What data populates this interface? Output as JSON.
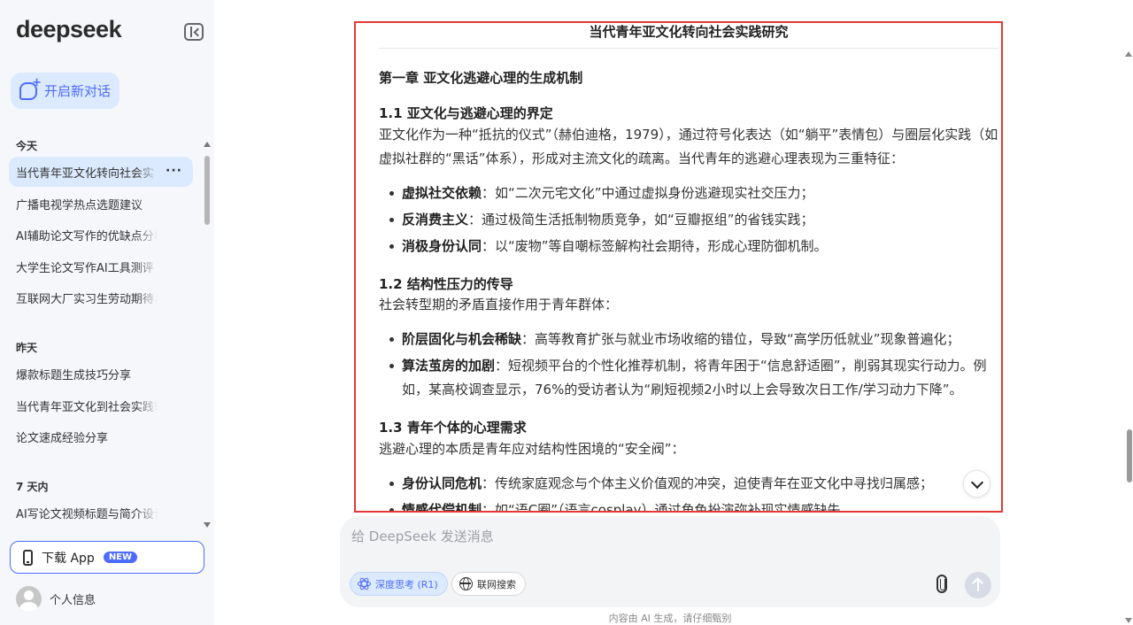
{
  "sidebar": {
    "logo": "deepseek",
    "new_chat_label": "开启新对话",
    "sections": [
      {
        "label": "今天",
        "items": [
          "当代青年亚文化转向社会实",
          "广播电视学热点选题建议",
          "AI辅助论文写作的优缺点分析",
          "大学生论文写作AI工具测评",
          "互联网大厂实习生劳动期待与剧本"
        ]
      },
      {
        "label": "昨天",
        "items": [
          "爆款标题生成技巧分享",
          "当代青年亚文化到社会实践转化研究",
          "论文速成经验分享"
        ]
      },
      {
        "label": "7 天内",
        "items": [
          "AI写论文视频标题与简介设计"
        ]
      }
    ],
    "more_label": "···",
    "download_label": "下载 App",
    "new_badge": "NEW",
    "profile_label": "个人信息"
  },
  "doc": {
    "title": "当代青年亚文化转向社会实践研究",
    "chapter": "第一章 亚文化逃避心理的生成机制",
    "s1": {
      "heading": "1.1 亚文化与逃避心理的界定",
      "intro": "亚文化作为一种“抵抗的仪式”（赫伯迪格，1979），通过符号化表达（如“躺平”表情包）与圈层化实践（如虚拟社群的“黑话”体系），形成对主流文化的疏离。当代青年的逃避心理表现为三重特征：",
      "bullets": [
        {
          "term": "虚拟社交依赖",
          "text": "：如“二次元宅文化”中通过虚拟身份逃避现实社交压力；"
        },
        {
          "term": "反消费主义",
          "text": "：通过极简生活抵制物质竞争，如“豆瓣抠组”的省钱实践；"
        },
        {
          "term": "消极身份认同",
          "text": "：以“废物”等自嘲标签解构社会期待，形成心理防御机制。"
        }
      ]
    },
    "s2": {
      "heading": "1.2 结构性压力的传导",
      "intro": "社会转型期的矛盾直接作用于青年群体：",
      "bullets": [
        {
          "term": "阶层固化与机会稀缺",
          "text": "：高等教育扩张与就业市场收缩的错位，导致“高学历低就业”现象普遍化；"
        },
        {
          "term": "算法茧房的加剧",
          "text": "：短视频平台的个性化推荐机制，将青年困于“信息舒适圈”，削弱其现实行动力。例如，某高校调查显示，76%的受访者认为“刷短视频2小时以上会导致次日工作/学习动力下降”。"
        }
      ]
    },
    "s3": {
      "heading": "1.3 青年个体的心理需求",
      "intro": "逃避心理的本质是青年应对结构性困境的“安全阀”：",
      "bullets": [
        {
          "term": "身份认同危机",
          "text": "：传统家庭观念与个体主义价值观的冲突，迫使青年在亚文化中寻找归属感；"
        },
        {
          "term": "情感代偿机制",
          "text": "：如“语C圈”（语言cosplay）通过角色扮演弥补现实情感缺失。"
        }
      ]
    }
  },
  "composer": {
    "placeholder": "给 DeepSeek 发送消息",
    "deep_think_label": "深度思考 (R1)",
    "web_search_label": "联网搜索",
    "disclaimer": "内容由 AI 生成，请仔细甄别"
  },
  "colors": {
    "accent": "#4d6bfe",
    "highlight_frame": "#e53935"
  }
}
